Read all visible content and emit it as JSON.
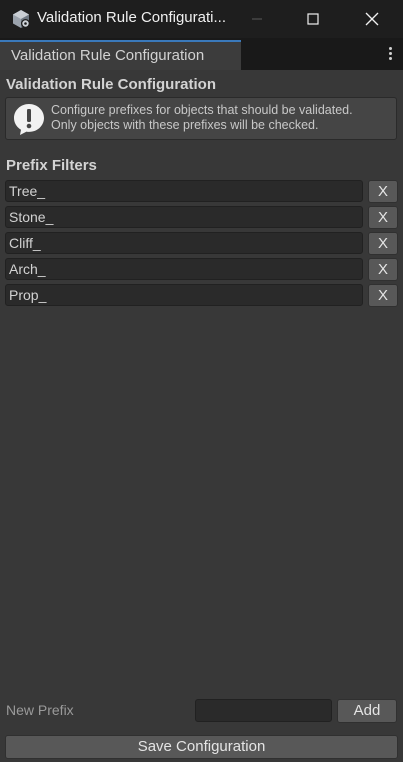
{
  "window": {
    "title": "Validation Rule Configurati...",
    "app_icon": "unity-cube-gear-icon"
  },
  "tab": {
    "label": "Validation Rule Configuration"
  },
  "content": {
    "heading": "Validation Rule Configuration",
    "help": {
      "icon": "info-exclamation-icon",
      "line1": "Configure prefixes for objects that should be validated.",
      "line2": "Only objects with these prefixes will be checked."
    },
    "filters_heading": "Prefix Filters",
    "prefixes": [
      {
        "value": "Tree_",
        "remove_label": "X"
      },
      {
        "value": "Stone_",
        "remove_label": "X"
      },
      {
        "value": "Cliff_",
        "remove_label": "X"
      },
      {
        "value": "Arch_",
        "remove_label": "X"
      },
      {
        "value": "Prop_",
        "remove_label": "X"
      }
    ],
    "new_prefix": {
      "label": "New Prefix",
      "value": "",
      "add_label": "Add"
    },
    "save_label": "Save Configuration"
  },
  "colors": {
    "accent": "#3a79bb",
    "background": "#383838",
    "titlebar": "#1e1e1e",
    "button": "#585858",
    "field": "#2a2a2a"
  }
}
